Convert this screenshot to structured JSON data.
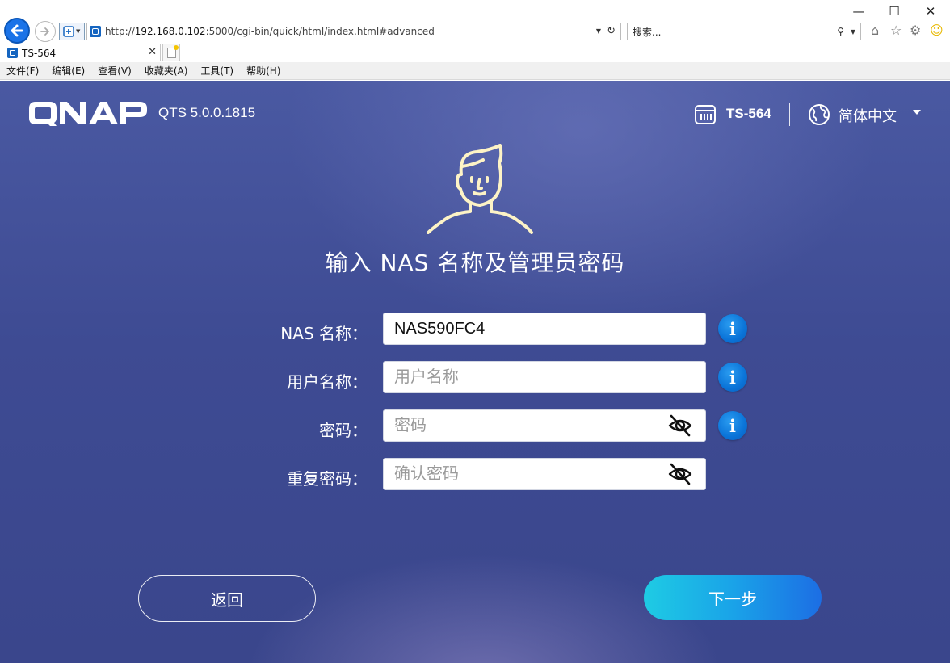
{
  "browser": {
    "url_prefix": "http://",
    "url_host": "192.168.0.102",
    "url_rest": ":5000/cgi-bin/quick/html/index.html#advanced",
    "search_placeholder": "搜索...",
    "tab_title": "TS-564",
    "menu": [
      "文件(F)",
      "编辑(E)",
      "查看(V)",
      "收藏夹(A)",
      "工具(T)",
      "帮助(H)"
    ]
  },
  "header": {
    "version": "QTS 5.0.0.1815",
    "model": "TS-564",
    "language": "简体中文"
  },
  "form": {
    "title": "输入 NAS 名称及管理员密码",
    "nas_name_label": "NAS 名称：",
    "nas_name_value": "NAS590FC4",
    "username_label": "用户名称：",
    "username_placeholder": "用户名称",
    "password_label": "密码：",
    "password_placeholder": "密码",
    "confirm_label": "重复密码：",
    "confirm_placeholder": "确认密码"
  },
  "buttons": {
    "back": "返回",
    "next": "下一步"
  },
  "icons": {
    "info": "i"
  },
  "colors": {
    "info_blue": "#0a73d8",
    "next_gradient_start": "#1ecbe4",
    "next_gradient_end": "#1c6ee4"
  }
}
